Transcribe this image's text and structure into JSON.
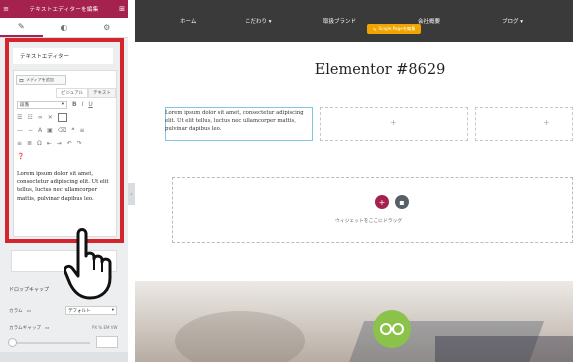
{
  "panel": {
    "header_title": "テキストエディターを編集",
    "section_title": "テキストエディター",
    "media_button": "メディアを追加",
    "tab_visual": "ビジュアル",
    "tab_text": "テキスト",
    "format_select": "段落",
    "editor_content": "Lorem ipsum dolor sit amet, consectetur adipiscing elit. Ut elit tellus, luctus nec ullamcorper mattis, pulvinar dapibus leo.",
    "drop_cap_label": "ドロップキャップ",
    "columns_label": "カラム",
    "columns_value": "デフォルト",
    "column_gap_label": "カラムギャップ",
    "units": "PX  % EM  VW"
  },
  "nav": {
    "items": [
      "ホーム",
      "こだわり ▾",
      "取扱ブランド",
      "会社概要",
      "ブログ ▾"
    ],
    "single_badge": "Single Pageを編集"
  },
  "content": {
    "page_title": "Elementor #8629",
    "column_text": "Lorem ipsum dolor sit amet, consectetur adipiscing elit. Ut elit tellus, luctus nec ullamcorper mattis, pulvinar dapibus leo.",
    "drop_hint": "ウィジェットをここにドラッグ"
  },
  "colors": {
    "accent": "#a4224d",
    "highlight": "#d4252f",
    "nav_bg": "#3a3a3a",
    "logo": "#8bc34a"
  }
}
